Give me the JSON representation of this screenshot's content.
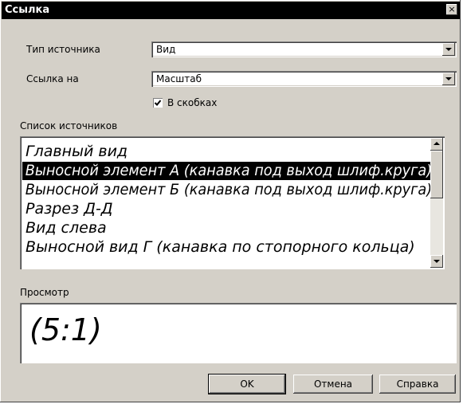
{
  "window": {
    "title": "Ссылка",
    "close_label": "×"
  },
  "source_type": {
    "label": "Тип источника",
    "value": "Вид"
  },
  "link_to": {
    "label": "Ссылка на",
    "value": "Масштаб"
  },
  "brackets": {
    "label": "В скобках",
    "checked": true
  },
  "source_list": {
    "label": "Список источников",
    "items": [
      "Главный вид",
      "Выносной элемент А  (канавка под выход шлиф.круга)",
      "Выносной элемент Б (канавка под выход шлиф.круга)",
      "Разрез Д-Д",
      "Вид слева",
      "Выносной вид Г (канавка по стопорного кольца)"
    ],
    "selected_index": 1
  },
  "preview": {
    "label": "Просмотр",
    "value": "(5:1)"
  },
  "buttons": {
    "ok": "OK",
    "cancel": "Отмена",
    "help": "Справка"
  },
  "icons": {
    "dropdown": "chevron-down-icon",
    "scroll_up": "arrow-up-icon",
    "scroll_down": "arrow-down-icon",
    "check": "checkmark-icon"
  }
}
